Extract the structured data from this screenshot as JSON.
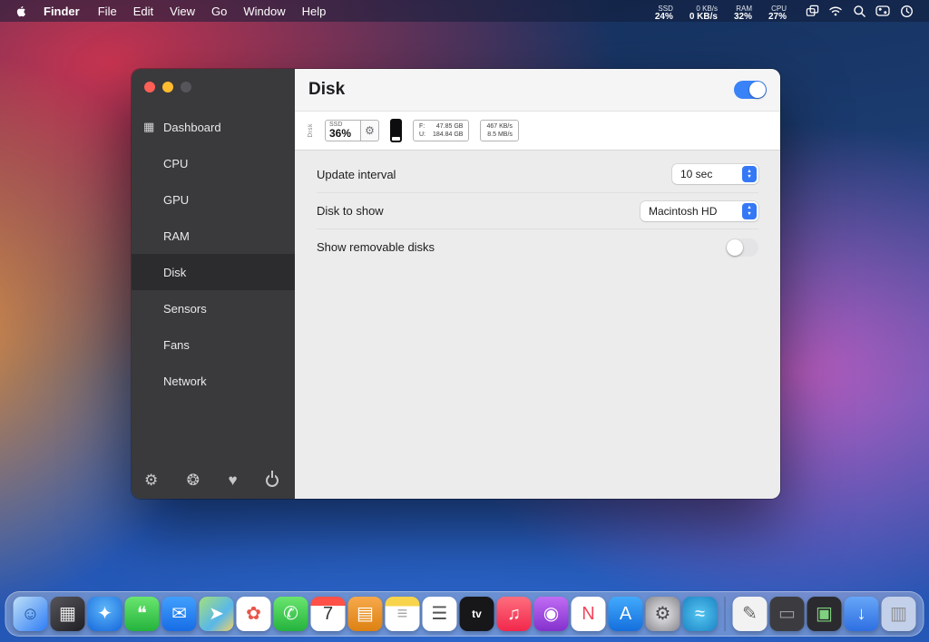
{
  "menu_bar": {
    "app_name": "Finder",
    "menus": [
      "File",
      "Edit",
      "View",
      "Go",
      "Window",
      "Help"
    ],
    "status_items": [
      {
        "line1": "SSD",
        "line2": "24%"
      },
      {
        "line1": "0 KB/s",
        "line2": "0 KB/s"
      },
      {
        "line1": "RAM",
        "line2": "32%"
      },
      {
        "line1": "CPU",
        "line2": "27%"
      }
    ],
    "icons": [
      "windows-icon",
      "wifi-icon",
      "search-icon",
      "control-center-icon",
      "clock-icon"
    ]
  },
  "window": {
    "sidebar": {
      "items": [
        {
          "label": "Dashboard",
          "icon": "grid-icon",
          "selected": false
        },
        {
          "label": "CPU",
          "selected": false
        },
        {
          "label": "GPU",
          "selected": false
        },
        {
          "label": "RAM",
          "selected": false
        },
        {
          "label": "Disk",
          "selected": true
        },
        {
          "label": "Sensors",
          "selected": false
        },
        {
          "label": "Fans",
          "selected": false
        },
        {
          "label": "Network",
          "selected": false
        }
      ],
      "footer_icons": [
        "settings-gear-icon",
        "bug-icon",
        "donate-heart-icon",
        "power-icon"
      ]
    },
    "header": {
      "title": "Disk",
      "module_enabled": true
    },
    "widget_preview": {
      "orientation_label": "Disk",
      "percent_widget": {
        "top_label": "SSD",
        "value": "36%"
      },
      "usage_widget": {
        "rows": [
          {
            "k": "F:",
            "v": "47.85 GB"
          },
          {
            "k": "U:",
            "v": "184.84 GB"
          }
        ]
      },
      "speed_widget": {
        "rows": [
          "467 KB/s",
          "8.5 MB/s"
        ]
      }
    },
    "settings": {
      "update_interval": {
        "label": "Update interval",
        "value": "10 sec"
      },
      "disk_to_show": {
        "label": "Disk to show",
        "value": "Macintosh HD"
      },
      "show_removable": {
        "label": "Show removable disks",
        "enabled": false
      }
    }
  },
  "dock": {
    "items": [
      {
        "name": "finder",
        "glyph": "☺",
        "bg": "linear-gradient(135deg,#bfe0f7 0%,#2e7cf6 100%)",
        "fg": "#1a4f9c"
      },
      {
        "name": "launchpad",
        "glyph": "▦",
        "bg": "linear-gradient(145deg,#55555b,#1f1f23)",
        "fg": "#e8e8e8"
      },
      {
        "name": "safari",
        "glyph": "✦",
        "bg": "radial-gradient(circle at 50% 35%,#5db6f8,#1668dc)",
        "fg": "#ffffff"
      },
      {
        "name": "messages",
        "glyph": "❝",
        "bg": "linear-gradient(180deg,#6ae66e,#24b33e)",
        "fg": "#ffffff"
      },
      {
        "name": "mail",
        "glyph": "✉",
        "bg": "linear-gradient(180deg,#41a0fd,#176ce5)",
        "fg": "#ffffff"
      },
      {
        "name": "maps",
        "glyph": "➤",
        "bg": "linear-gradient(135deg,#a4e07c 0%,#58b7ea 60%,#f2d264 100%)",
        "fg": "#ffffff"
      },
      {
        "name": "photos",
        "glyph": "✿",
        "bg": "#ffffff",
        "fg": "#e8554a"
      },
      {
        "name": "facetime",
        "glyph": "✆",
        "bg": "linear-gradient(180deg,#6ae66e,#24b33e)",
        "fg": "#ffffff"
      },
      {
        "name": "calendar",
        "glyph": "7",
        "bg": "linear-gradient(180deg,#ff5147 0%,#ff5147 26%,#ffffff 26%)",
        "fg": "#333333"
      },
      {
        "name": "books",
        "glyph": "▤",
        "bg": "linear-gradient(180deg,#f7a94b,#dd8112)",
        "fg": "#ffffff"
      },
      {
        "name": "notes",
        "glyph": "≡",
        "bg": "linear-gradient(180deg,#f7d44c 0%,#f7d44c 28%,#ffffff 28%)",
        "fg": "#a5a5a5"
      },
      {
        "name": "reminders",
        "glyph": "☰",
        "bg": "#ffffff",
        "fg": "#555555"
      },
      {
        "name": "tv",
        "glyph": "tv",
        "bg": "#17171a",
        "fg": "#ffffff"
      },
      {
        "name": "music",
        "glyph": "♫",
        "bg": "linear-gradient(180deg,#fd6e7d,#f2274c)",
        "fg": "#ffffff"
      },
      {
        "name": "podcasts",
        "glyph": "◉",
        "bg": "linear-gradient(180deg,#c06cf4,#8431cd)",
        "fg": "#ffffff"
      },
      {
        "name": "news",
        "glyph": "N",
        "bg": "#ffffff",
        "fg": "#f5455c"
      },
      {
        "name": "app-store",
        "glyph": "A",
        "bg": "linear-gradient(180deg,#42aafc,#156fdd)",
        "fg": "#ffffff"
      },
      {
        "name": "system-preferences",
        "glyph": "⚙",
        "bg": "radial-gradient(circle,#d8d8dc 20%,#85858b)",
        "fg": "#4b4b50"
      },
      {
        "name": "stats",
        "glyph": "≈",
        "bg": "radial-gradient(circle,#56c6f2,#1b84c4)",
        "fg": "#ffffff"
      },
      {
        "sep": true
      },
      {
        "name": "minimized-document",
        "glyph": "✎",
        "bg": "#f2f2f2",
        "fg": "#666666"
      },
      {
        "name": "minimized-window-1",
        "glyph": "▭",
        "bg": "#3c3c40",
        "fg": "#9a9aa0"
      },
      {
        "name": "minimized-window-2",
        "glyph": "▣",
        "bg": "#2b2b2f",
        "fg": "#7fd17f"
      },
      {
        "name": "downloads",
        "glyph": "↓",
        "bg": "linear-gradient(180deg,#66a6f8,#2e6fe2)",
        "fg": "#ffffff"
      },
      {
        "name": "trash",
        "glyph": "▥",
        "bg": "rgba(255,255,255,0.6)",
        "fg": "#909095"
      }
    ]
  }
}
